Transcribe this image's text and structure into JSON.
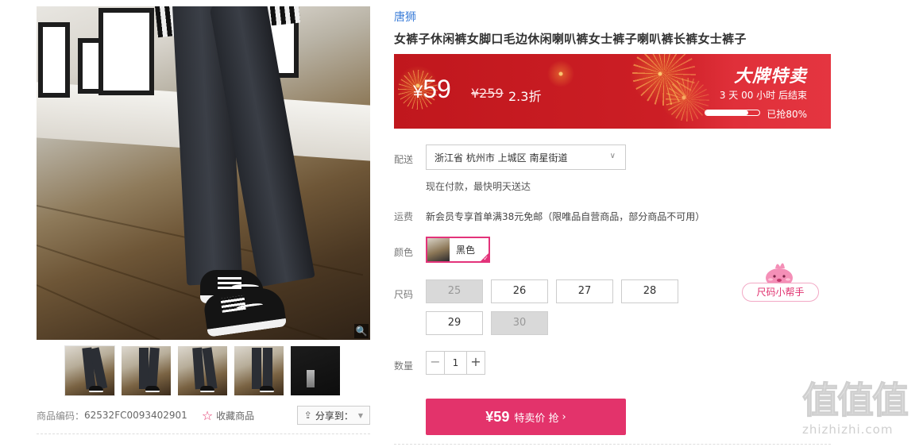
{
  "gallery": {
    "zoom_icon": "🔍",
    "thumbnail_count": 5,
    "active_thumbnail": 1
  },
  "meta": {
    "sku_label": "商品编码：",
    "sku_value": "62532FC0093402901",
    "favorite_icon": "☆",
    "favorite_label": "收藏商品",
    "share_icon": "⇪",
    "share_label": "分享到：",
    "share_caret": "▼"
  },
  "product": {
    "brand": "唐狮",
    "title": "女裤子休闲裤女脚口毛边休闲喇叭裤女士裤子喇叭裤长裤女士裤子"
  },
  "price_banner": {
    "currency": "¥",
    "price": "59",
    "original_price": "¥259",
    "discount": "2.3折",
    "sale_title": "大牌特卖",
    "countdown": "3  天  00  小时  后结束",
    "sold_percent": 80,
    "sold_text": "已抢80%",
    "colors": {
      "banner": "#c91b22"
    }
  },
  "delivery": {
    "label": "配送",
    "address": "浙江省  杭州市  上城区  南星街道",
    "chevron": "∨",
    "note": "现在付款，最快明天送达"
  },
  "shipping": {
    "label": "运费",
    "text": "新会员专享首单满38元免邮（限唯品自营商品，部分商品不可用）"
  },
  "color": {
    "label": "颜色",
    "selected": "黑色",
    "check": "✓"
  },
  "size": {
    "label": "尺码",
    "options": [
      {
        "value": "25",
        "available": false
      },
      {
        "value": "26",
        "available": true
      },
      {
        "value": "27",
        "available": true
      },
      {
        "value": "28",
        "available": true
      },
      {
        "value": "29",
        "available": true
      },
      {
        "value": "30",
        "available": false
      }
    ],
    "helper_label": "尺码小帮手"
  },
  "quantity": {
    "label": "数量",
    "minus": "−",
    "value": "1",
    "plus": "+"
  },
  "buy": {
    "price": "¥59",
    "label": "特卖价 抢",
    "arrow": "›",
    "color": "#e3336b"
  },
  "watermark": {
    "logo": "值值值",
    "url": "zhizhizhi.com"
  }
}
